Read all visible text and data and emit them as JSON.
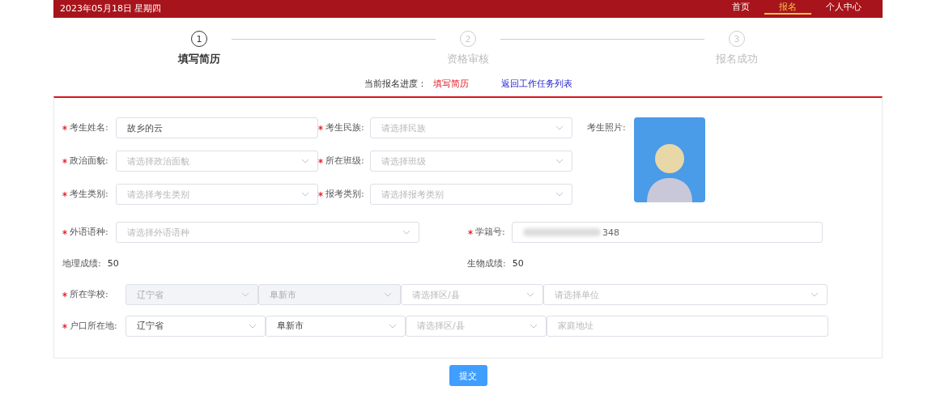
{
  "header": {
    "date": "2023年05月18日 星期四",
    "nav": [
      {
        "label": "首页",
        "selected": false
      },
      {
        "label": "报名",
        "selected": true
      },
      {
        "label": "个人中心",
        "selected": false
      }
    ]
  },
  "steps": [
    {
      "number": "1",
      "label": "填写简历",
      "selected": true
    },
    {
      "number": "2",
      "label": "资格审核",
      "selected": false
    },
    {
      "number": "3",
      "label": "报名成功",
      "selected": false
    }
  ],
  "progress": {
    "label": "当前报名进度：",
    "value": "填写简历",
    "link": "返回工作任务列表"
  },
  "form": {
    "grid_fields": [
      {
        "label": "考生姓名:",
        "required": true,
        "kind": "input",
        "value": "故乡的云"
      },
      {
        "label": "考生民族:",
        "required": true,
        "kind": "select",
        "placeholder": "请选择民族"
      },
      {
        "label": "政治面貌:",
        "required": true,
        "kind": "select",
        "placeholder": "请选择政治面貌"
      },
      {
        "label": "所在班级:",
        "required": true,
        "kind": "select",
        "placeholder": "请选择班级"
      },
      {
        "label": "考生类别:",
        "required": true,
        "kind": "select",
        "placeholder": "请选择考生类别"
      },
      {
        "label": "报考类别:",
        "required": true,
        "kind": "select",
        "placeholder": "请选择报考类别"
      }
    ],
    "photo": {
      "label": "考生照片:"
    },
    "foreign_language": {
      "label": "外语语种:",
      "required": true,
      "placeholder": "请选择外语语种"
    },
    "student_id": {
      "label": "学籍号:",
      "required": true,
      "value": "348"
    },
    "scores": [
      {
        "label": "地理成绩:",
        "value": "50"
      },
      {
        "label": "生物成绩:",
        "value": "50"
      }
    ],
    "school": {
      "label": "所在学校:",
      "required": true,
      "parts": [
        {
          "kind": "select",
          "value": "辽宁省",
          "disabled": true
        },
        {
          "kind": "select",
          "value": "阜新市",
          "disabled": true
        },
        {
          "kind": "select",
          "placeholder": "请选择区/县",
          "disabled": false
        },
        {
          "kind": "select",
          "placeholder": "请选择单位",
          "disabled": false
        }
      ]
    },
    "hukou": {
      "label": "户口所在地:",
      "required": true,
      "parts": [
        {
          "kind": "select",
          "value": "辽宁省",
          "disabled": false
        },
        {
          "kind": "select",
          "value": "阜新市",
          "disabled": false
        },
        {
          "kind": "select",
          "placeholder": "请选择区/县",
          "disabled": false
        },
        {
          "kind": "input",
          "placeholder": "家庭地址",
          "disabled": false
        }
      ]
    }
  },
  "submit": "提交"
}
